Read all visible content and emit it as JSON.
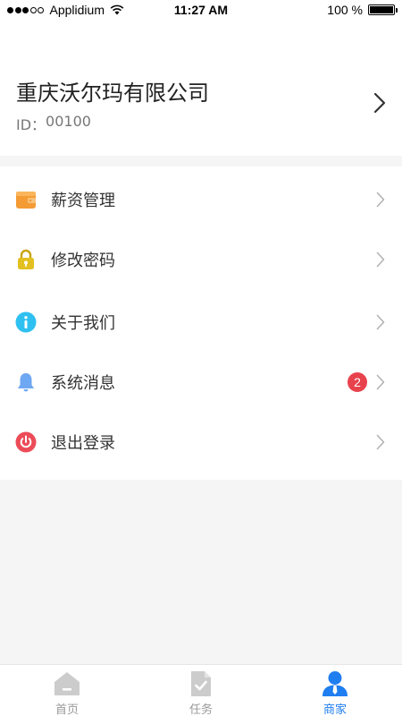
{
  "status_bar": {
    "carrier": "Applidium",
    "time": "11:27 AM",
    "battery_text": "100 %",
    "battery_level": 1.0
  },
  "header": {
    "company_name": "重庆沃尔玛有限公司",
    "id_label": "ID：",
    "id_value": "00100"
  },
  "menu": {
    "items": [
      {
        "label": "薪资管理",
        "icon": "wallet-icon"
      },
      {
        "label": "修改密码",
        "icon": "lock-icon"
      },
      {
        "label": "关于我们",
        "icon": "info-icon"
      },
      {
        "label": "系统消息",
        "icon": "bell-icon",
        "badge": "2"
      },
      {
        "label": "退出登录",
        "icon": "power-icon"
      }
    ]
  },
  "tabbar": {
    "tabs": [
      {
        "label": "首页",
        "icon": "home-icon"
      },
      {
        "label": "任务",
        "icon": "task-icon"
      },
      {
        "label": "商家",
        "icon": "merchant-icon",
        "active": true
      }
    ]
  },
  "colors": {
    "accent": "#1f7ef0",
    "badge": "#e8424c",
    "wallet": "#f59b34",
    "lock": "#e3c021",
    "info": "#2ec0f0",
    "bell": "#6fa8f2",
    "power": "#ec4b58",
    "tab_inactive": "#cccccc"
  }
}
